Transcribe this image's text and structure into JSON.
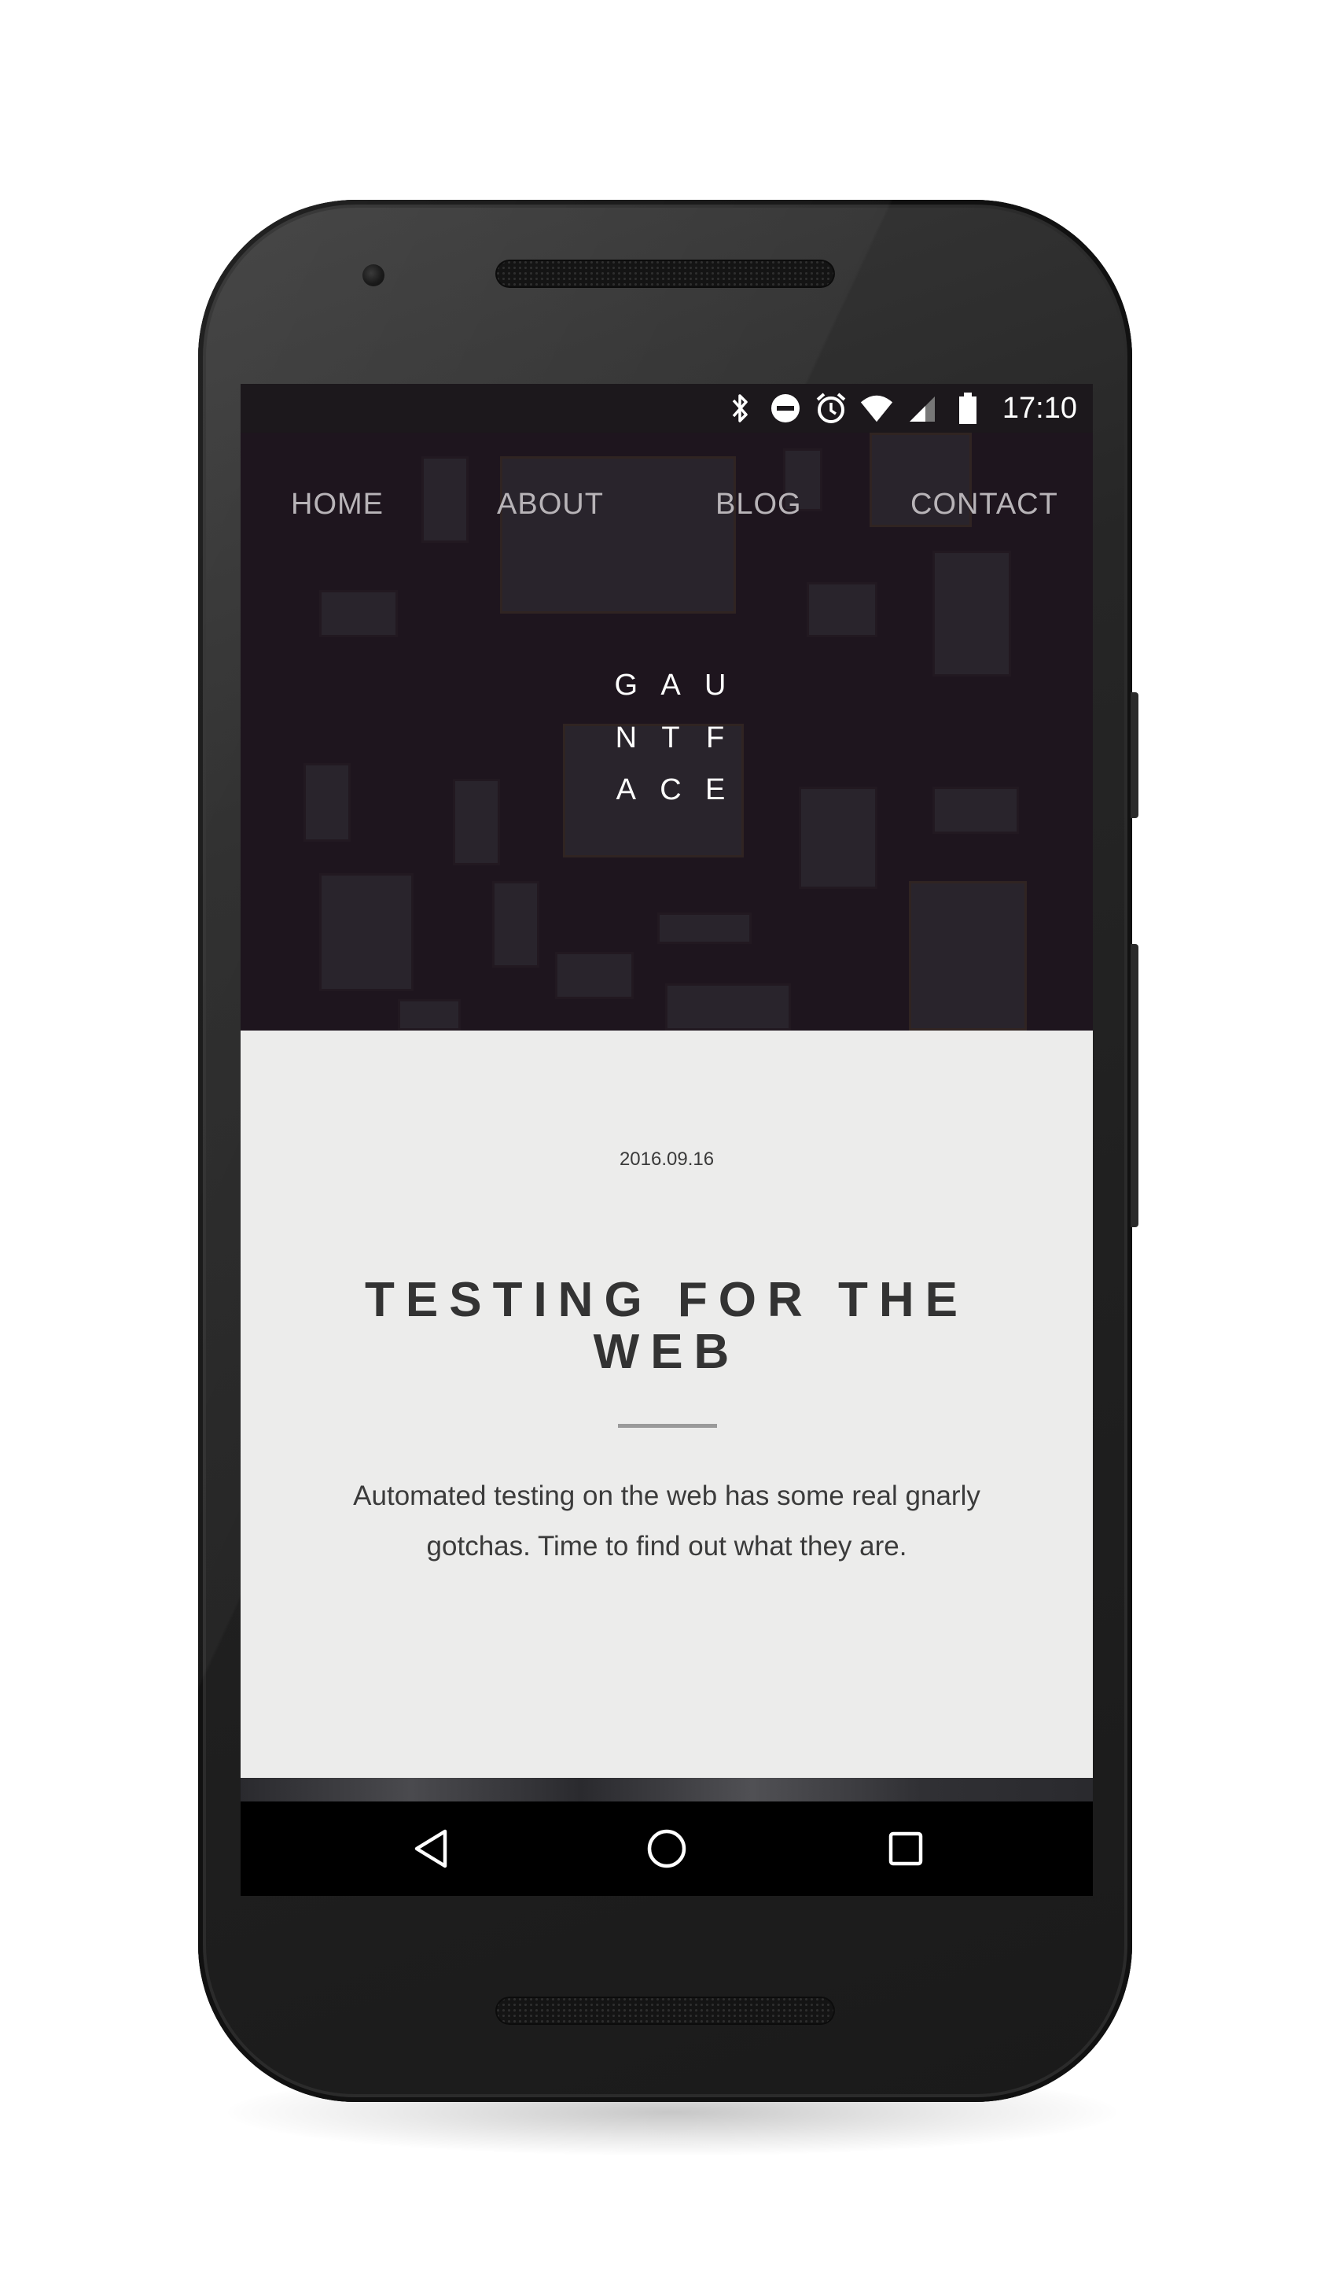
{
  "status_bar": {
    "time": "17:10",
    "icons": [
      "bluetooth-icon",
      "do-not-disturb-icon",
      "alarm-icon",
      "wifi-icon",
      "cell-signal-icon",
      "battery-icon"
    ]
  },
  "site_nav": {
    "items": [
      {
        "label": "HOME"
      },
      {
        "label": "ABOUT"
      },
      {
        "label": "BLOG"
      },
      {
        "label": "CONTACT"
      }
    ]
  },
  "logo": {
    "letters": [
      "G",
      "A",
      "U",
      "N",
      "T",
      "F",
      "A",
      "C",
      "E"
    ]
  },
  "article": {
    "date": "2016.09.16",
    "title": "TESTING FOR THE WEB",
    "excerpt": "Automated testing on the web has some real gnarly gotchas. Time to find out what they are."
  },
  "system_nav": {
    "buttons": [
      "back-icon",
      "home-icon",
      "recents-icon"
    ]
  },
  "colors": {
    "hero_background": "#231a23",
    "article_background": "#ececeb",
    "title_text": "#333333",
    "nav_text": "#b8b4b8"
  }
}
